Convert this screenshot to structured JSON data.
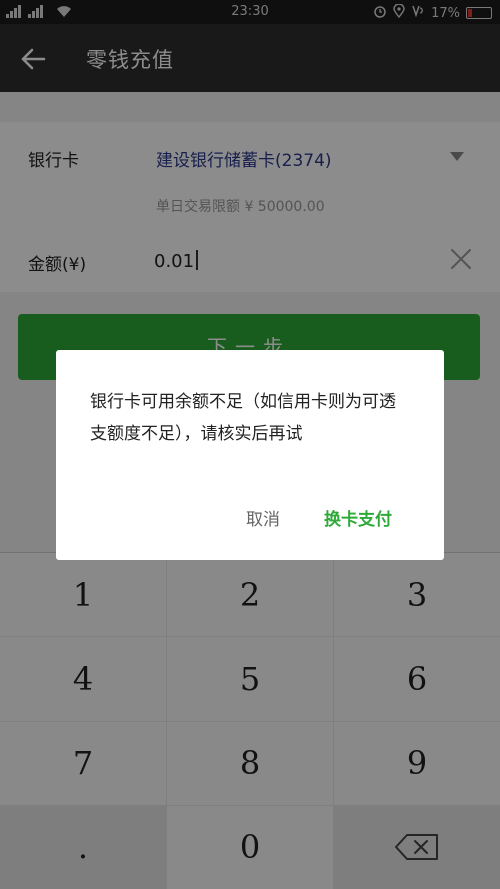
{
  "status_bar": {
    "signal_text": "📶📶",
    "time": "23:30",
    "battery_text": "17%",
    "battery_level": 0.17,
    "icons": [
      "alarm-icon",
      "location-icon",
      "volte-icon"
    ]
  },
  "app_bar": {
    "title": "零钱充值",
    "back_icon": "arrow-left-icon"
  },
  "form": {
    "card_label": "银行卡",
    "card_name": "建设银行储蓄卡(2374)",
    "limit_text": "单日交易限额 ¥ 50000.00",
    "amount_label": "金额(¥)",
    "amount_value": "0.01"
  },
  "next_button": "下一步",
  "dialog": {
    "message": "银行卡可用余额不足（如信用卡则为可透支额度不足），请核实后再试",
    "cancel": "取消",
    "confirm": "换卡支付"
  },
  "keypad": {
    "keys": [
      "1",
      "2",
      "3",
      "4",
      "5",
      "6",
      "7",
      "8",
      "9",
      ".",
      "0"
    ]
  },
  "colors": {
    "accent_green": "#2faa38",
    "app_bar": "#2e2e2e",
    "battery_low": "#e53935"
  }
}
